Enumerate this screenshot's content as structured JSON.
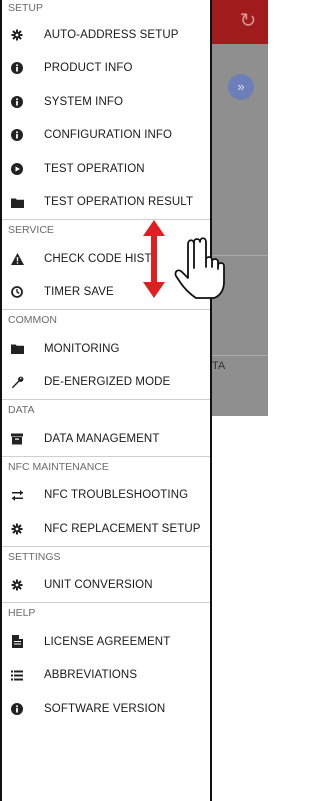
{
  "drawer": {
    "sections": [
      {
        "header": "SETUP",
        "items": [
          {
            "label": "AUTO-ADDRESS SETUP",
            "icon": "gear-icon"
          },
          {
            "label": "PRODUCT INFO",
            "icon": "info-icon"
          },
          {
            "label": "SYSTEM INFO",
            "icon": "info-icon"
          },
          {
            "label": "CONFIGURATION INFO",
            "icon": "info-icon"
          },
          {
            "label": "TEST OPERATION",
            "icon": "play-icon"
          },
          {
            "label": "TEST OPERATION RESULT",
            "icon": "folder-icon"
          }
        ]
      },
      {
        "header": "SERVICE",
        "items": [
          {
            "label": "CHECK CODE HIST",
            "icon": "warning-icon"
          },
          {
            "label": "TIMER SAVE",
            "icon": "clock-icon"
          }
        ]
      },
      {
        "header": "COMMON",
        "items": [
          {
            "label": "MONITORING",
            "icon": "folder-icon"
          },
          {
            "label": "DE-ENERGIZED MODE",
            "icon": "wrench-icon"
          }
        ]
      },
      {
        "header": "DATA",
        "items": [
          {
            "label": "DATA MANAGEMENT",
            "icon": "archive-icon"
          }
        ]
      },
      {
        "header": "NFC MAINTENANCE",
        "items": [
          {
            "label": "NFC TROUBLESHOOTING",
            "icon": "swap-icon"
          },
          {
            "label": "NFC REPLACEMENT SETUP",
            "icon": "gear-icon"
          }
        ]
      },
      {
        "header": "SETTINGS",
        "items": [
          {
            "label": "UNIT CONVERSION",
            "icon": "gear-icon"
          }
        ]
      },
      {
        "header": "HELP",
        "items": [
          {
            "label": "LICENSE AGREEMENT",
            "icon": "document-icon"
          },
          {
            "label": "ABBREVIATIONS",
            "icon": "list-icon"
          },
          {
            "label": "SOFTWARE VERSION",
            "icon": "info-icon"
          }
        ]
      }
    ]
  },
  "background": {
    "partial_text": "TA",
    "header_color": "#a01c1c",
    "refresh_icon": "refresh-icon",
    "badge_icon": "chevron-double-down-icon"
  },
  "gesture": {
    "arrow_color": "#e02020",
    "hand_icon": "swipe-hand-icon",
    "arrow_icon": "vertical-double-arrow-icon"
  }
}
